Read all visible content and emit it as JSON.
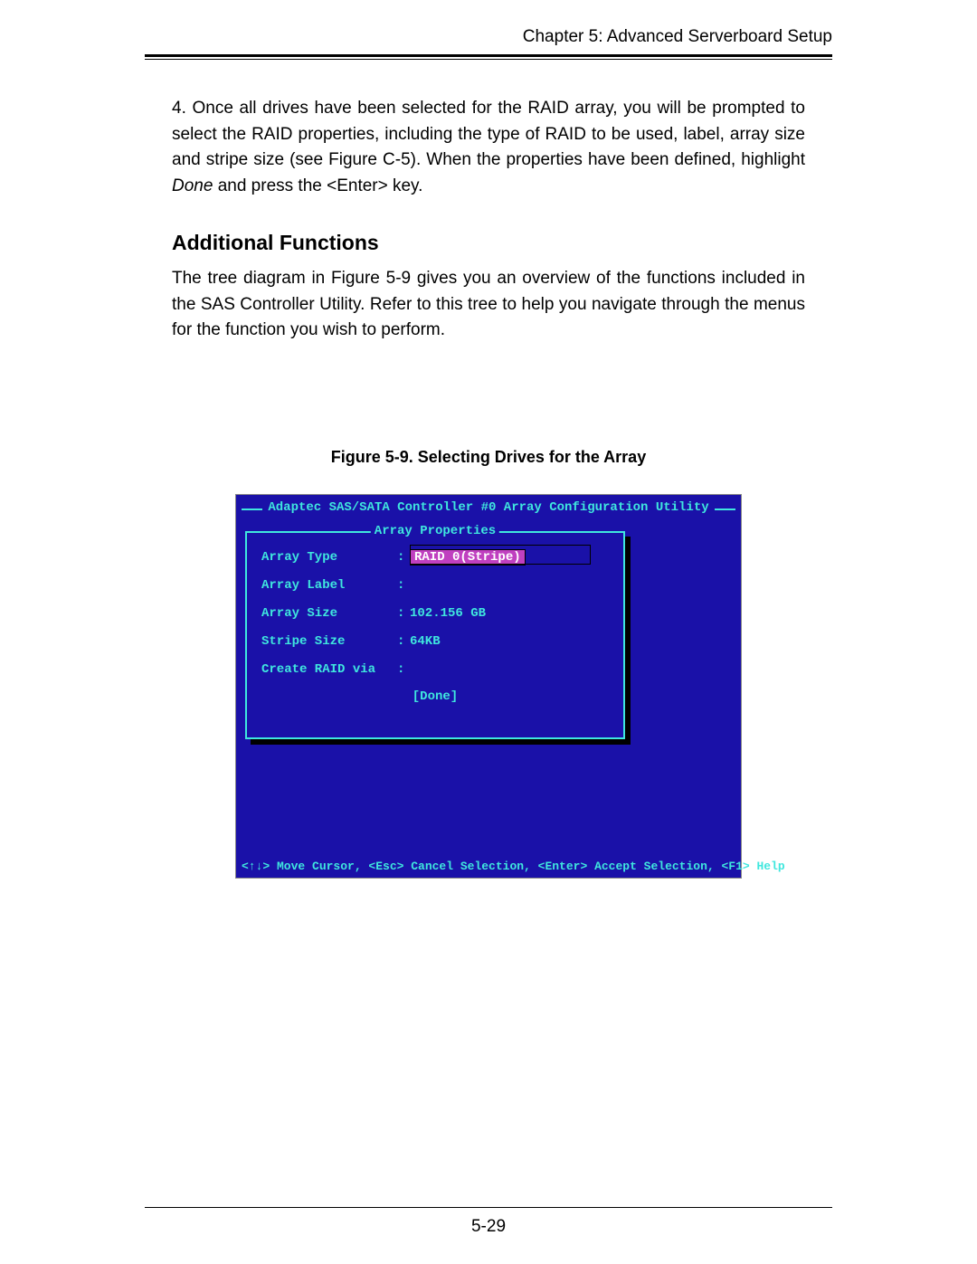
{
  "header": {
    "chapter": "Chapter 5: Advanced Serverboard Setup"
  },
  "para1": {
    "prefix": "4. Once all drives have been selected for the RAID array, you will be prompted to select the RAID properties, including the type of RAID to be used, label, array size and stripe size (see Figure C-5).  When the properties have been defined, highlight ",
    "done_word": "Done",
    "suffix": " and press the <Enter> key."
  },
  "section_heading": "Additional Functions",
  "para2": "The tree diagram in Figure 5-9 gives you an overview of the functions included in the SAS Controller Utility.  Refer to this tree to help you navigate through the menus for the function you wish to perform.",
  "figure_caption": "Figure 5-9. Selecting Drives for the Array",
  "bios": {
    "title": "Adaptec SAS/SATA Controller #0 Array Configuration Utility",
    "panel_title": "Array Properties",
    "rows": {
      "array_type": {
        "label": "Array Type",
        "value": "RAID 0(Stripe)"
      },
      "array_label": {
        "label": "Array Label",
        "value": ""
      },
      "array_size": {
        "label": "Array Size",
        "value": "102.156 GB"
      },
      "stripe_size": {
        "label": "Stripe Size",
        "value": "64KB"
      },
      "create_via": {
        "label": "Create RAID via",
        "value": ""
      }
    },
    "done_label": "[Done]",
    "footer": "<↑↓> Move Cursor, <Esc> Cancel Selection, <Enter> Accept Selection, <F1> Help"
  },
  "page_number": "5-29"
}
